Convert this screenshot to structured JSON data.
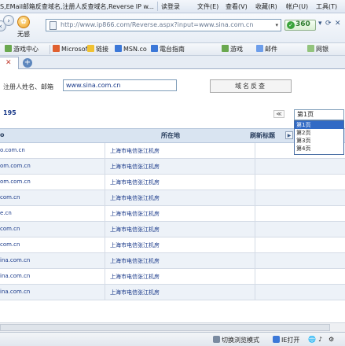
{
  "window": {
    "title": "S,EMail邮箱反查域名,注册人反查域名,Reverse IP w...",
    "menu": [
      "读登录",
      "文件(E)",
      "查看(V)",
      "收藏(R)",
      "帐户(U)",
      "工具(T)"
    ]
  },
  "nav": {
    "back_glyph": "‹",
    "forward_glyph": "›",
    "nosafe_label": "无感",
    "url": "http://www.ip866.com/Reverse.aspx?input=www.sina.com.cn",
    "security_label": "360",
    "dropdown_glyph": "▾"
  },
  "favorites": [
    "游戏中心",
    "Microsoft",
    "链接",
    "MSN.co",
    "電台指南",
    "游戏",
    "邮件",
    "网银"
  ],
  "search": {
    "label": "注册人姓名、邮箱",
    "value": "www.sina.com.cn",
    "button_label": "域名反查"
  },
  "results": {
    "count": "195",
    "prev_glyph": "≪",
    "page_select": {
      "value": "第1页",
      "options": [
        "第1页",
        "第2页",
        "第3页",
        "第4页"
      ]
    },
    "columns": [
      "所在地",
      "刷新标题"
    ],
    "rows": [
      {
        "domain": "o.com.cn",
        "location": "上海市电信张江机房"
      },
      {
        "domain": "om.com.cn",
        "location": "上海市电信张江机房"
      },
      {
        "domain": "om.com.cn",
        "location": "上海市电信张江机房"
      },
      {
        "domain": "com.cn",
        "location": "上海市电信张江机房"
      },
      {
        "domain": "e.cn",
        "location": "上海市电信张江机房"
      },
      {
        "domain": "com.cn",
        "location": "上海市电信张江机房"
      },
      {
        "domain": "com.cn",
        "location": "上海市电信张江机房"
      },
      {
        "domain": "ina.com.cn",
        "location": "上海市电信张江机房"
      },
      {
        "domain": "ina.com.cn",
        "location": "上海市电信张江机房"
      },
      {
        "domain": "ina.com.cn",
        "location": "上海市电信张江机房"
      }
    ]
  },
  "status": {
    "mode_label": "切换浏览模式",
    "ie_label": "IE打开"
  },
  "colors": {
    "link_blue": "#1a3a8a",
    "header_bg": "#d9e4f1",
    "row_alt": "#edf2f8",
    "selected_option": "#316ac5"
  }
}
